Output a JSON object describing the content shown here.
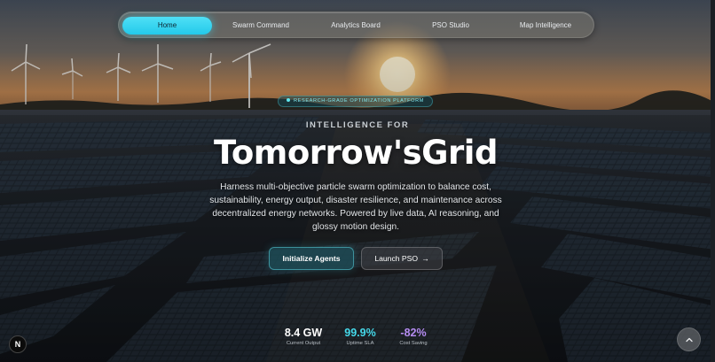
{
  "nav": {
    "items": [
      {
        "label": "Home",
        "active": true
      },
      {
        "label": "Swarm Command",
        "active": false
      },
      {
        "label": "Analytics Board",
        "active": false
      },
      {
        "label": "PSO Studio",
        "active": false
      },
      {
        "label": "Map Intelligence",
        "active": false
      }
    ]
  },
  "hero": {
    "badge": "RESEARCH-GRADE OPTIMIZATION PLATFORM",
    "eyebrow": "INTELLIGENCE FOR",
    "headline": "Tomorrow'sGrid",
    "description": "Harness multi-objective particle swarm optimization to balance cost, sustainability, energy output, disaster resilience, and maintenance across decentralized energy networks. Powered by live data, AI reasoning, and glossy motion design.",
    "primary_button": "Initialize Agents",
    "secondary_button": "Launch PSO",
    "secondary_icon": "arrow-right-icon"
  },
  "stats": [
    {
      "value": "8.4 GW",
      "label": "Current Output",
      "color": "#ffffff"
    },
    {
      "value": "99.9%",
      "label": "Uptime SLA",
      "color": "#45d9ea"
    },
    {
      "value": "-82%",
      "label": "Cost Saving",
      "color": "#b58cf2"
    }
  ],
  "floating": {
    "n_badge": "N",
    "scroll_top_icon": "chevron-up-icon"
  },
  "colors": {
    "accent": "#2fd3ef",
    "sky_top": "#4f5a66",
    "sunset": "#e7a15a"
  }
}
